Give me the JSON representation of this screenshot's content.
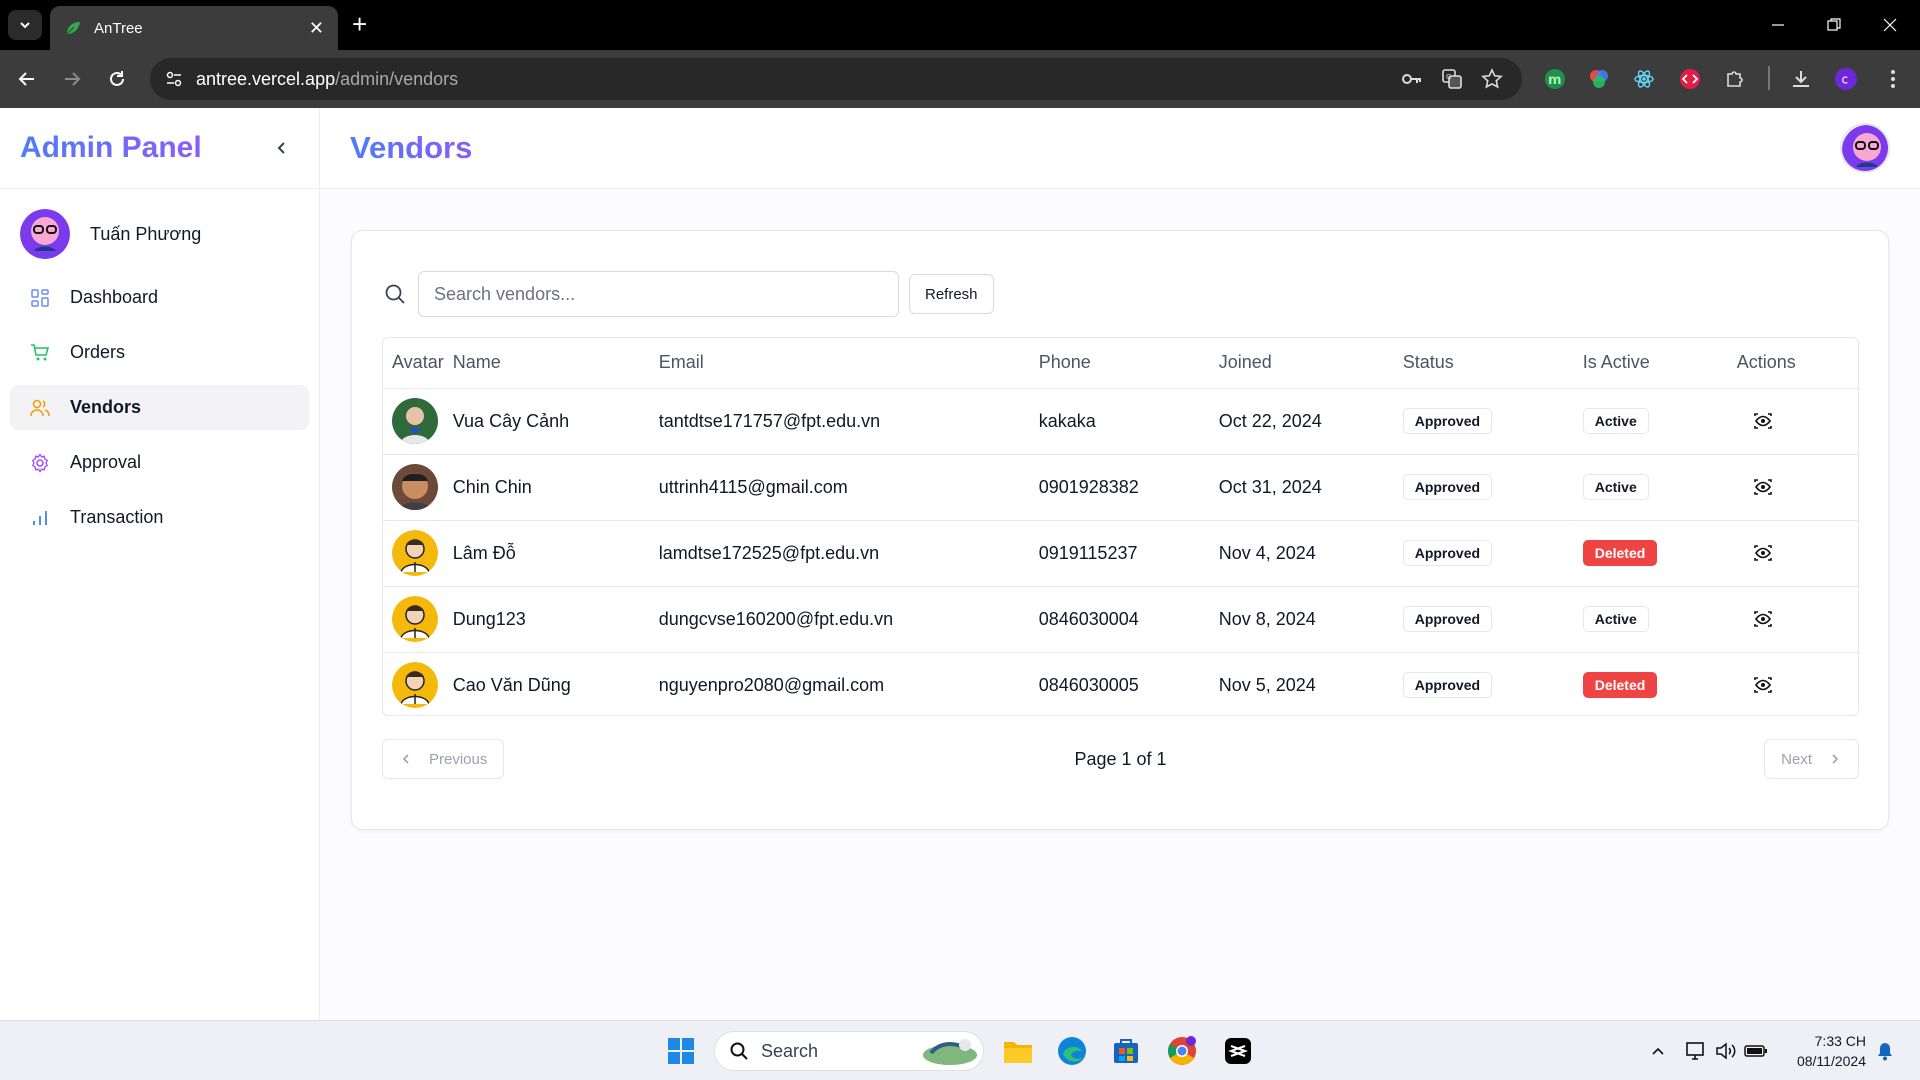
{
  "browser": {
    "tab_title": "AnTree",
    "url_host": "antree.vercel.app",
    "url_path": "/admin/vendors"
  },
  "sidebar": {
    "brand": "Admin Panel",
    "user_name": "Tuấn Phương",
    "items": [
      {
        "label": "Dashboard",
        "icon": "dashboard-icon",
        "color": "#6b8cf5"
      },
      {
        "label": "Orders",
        "icon": "cart-icon",
        "color": "#22c55e"
      },
      {
        "label": "Vendors",
        "icon": "users-icon",
        "color": "#f59e0b"
      },
      {
        "label": "Approval",
        "icon": "settings-icon",
        "color": "#a855f7"
      },
      {
        "label": "Transaction",
        "icon": "bar-chart-icon",
        "color": "#3b82f6"
      }
    ]
  },
  "header": {
    "title": "Vendors"
  },
  "search": {
    "placeholder": "Search vendors...",
    "refresh_label": "Refresh"
  },
  "table": {
    "columns": [
      "Avatar",
      "Name",
      "Email",
      "Phone",
      "Joined",
      "Status",
      "Is Active",
      "Actions"
    ],
    "rows": [
      {
        "name": "Vua Cây Cảnh",
        "email": "tantdtse171757@fpt.edu.vn",
        "phone": "kakaka",
        "joined": "Oct 22, 2024",
        "status": "Approved",
        "active": "Active",
        "avatar": "photo"
      },
      {
        "name": "Chin Chin",
        "email": "uttrinh4115@gmail.com",
        "phone": "0901928382",
        "joined": "Oct 31, 2024",
        "status": "Approved",
        "active": "Active",
        "avatar": "photo"
      },
      {
        "name": "Lâm Đỗ",
        "email": "lamdtse172525@fpt.edu.vn",
        "phone": "0919115237",
        "joined": "Nov 4, 2024",
        "status": "Approved",
        "active": "Deleted",
        "avatar": "default"
      },
      {
        "name": "Dung123",
        "email": "dungcvse160200@fpt.edu.vn",
        "phone": "0846030004",
        "joined": "Nov 8, 2024",
        "status": "Approved",
        "active": "Active",
        "avatar": "default"
      },
      {
        "name": "Cao Văn Dũng",
        "email": "nguyenpro2080@gmail.com",
        "phone": "0846030005",
        "joined": "Nov 5, 2024",
        "status": "Approved",
        "active": "Deleted",
        "avatar": "default"
      }
    ]
  },
  "pagination": {
    "previous": "Previous",
    "page_text": "Page 1 of 1",
    "next": "Next"
  },
  "taskbar": {
    "search_label": "Search",
    "time": "7:33 CH",
    "date": "08/11/2024"
  },
  "colors": {
    "accent_start": "#4f7df5",
    "accent_end": "#8b5cf6",
    "deleted": "#ef4444"
  }
}
